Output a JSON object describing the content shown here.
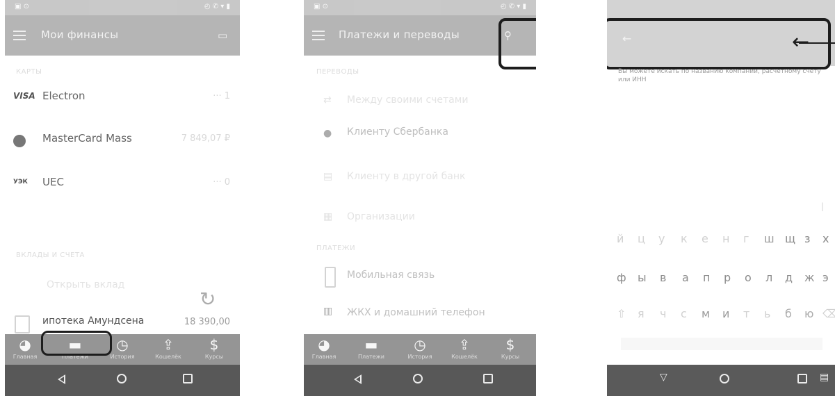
{
  "panel1": {
    "title": "Мои финансы",
    "cards": [
      {
        "logo": "VISA",
        "name": "Electron",
        "amount": "··· 1"
      },
      {
        "logo": "",
        "name": "MasterCard Mass",
        "amount": "7 849,07 ₽"
      },
      {
        "logo": "УЭК",
        "name": "UEC",
        "amount": "··· 0"
      }
    ],
    "section_label": "ВКЛАДЫ И СЧЕТА",
    "open_deposit": "Открыть вклад",
    "loan_name": "ипотека Амундсена",
    "loan_amount": "18 390,00"
  },
  "panel2": {
    "title": "Платежи и переводы",
    "section_label": "ПЕРЕВОДЫ",
    "items": [
      {
        "label": "Между своими счетами"
      },
      {
        "label": "Клиенту Сбербанка"
      },
      {
        "label": "Клиенту в другой банк"
      },
      {
        "label": "Организации"
      }
    ],
    "payments_label": "ПЛАТЕЖИ",
    "mobile_label": "Мобильная связь",
    "zhkh_label": "ЖКХ и домашний телефон"
  },
  "panel3": {
    "hint": "Вы можете искать по названию компании, расчетному счету или ИНН",
    "keyboard_rows": [
      [
        "й",
        "ц",
        "у",
        "к",
        "е",
        "н",
        "г",
        "ш",
        "щ",
        "з",
        "х"
      ],
      [
        "ф",
        "ы",
        "в",
        "а",
        "п",
        "р",
        "о",
        "л",
        "д",
        "ж",
        "э"
      ],
      [
        "⇧",
        "я",
        "ч",
        "с",
        "м",
        "и",
        "т",
        "ь",
        "б",
        "ю",
        "⌫"
      ]
    ]
  },
  "bottom_nav": [
    {
      "icon": "pie-chart-icon",
      "glyph": "◕",
      "label": "Главная"
    },
    {
      "icon": "transfer-icon",
      "glyph": "▬",
      "label": "Платежи"
    },
    {
      "icon": "clock-icon",
      "glyph": "◷",
      "label": "История"
    },
    {
      "icon": "upload-icon",
      "glyph": "⇪",
      "label": "Кошелёк"
    },
    {
      "icon": "currency-icon",
      "glyph": "$",
      "label": "Курсы"
    }
  ]
}
